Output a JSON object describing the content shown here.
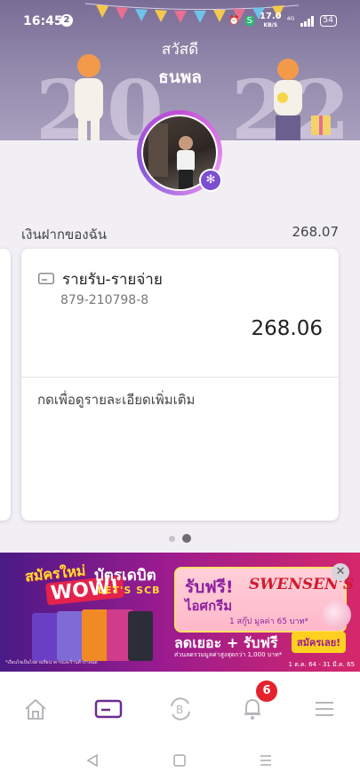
{
  "status_bar": {
    "time": "16:45",
    "notification_count": "2",
    "net_speed": "17.0",
    "net_unit": "KB/S",
    "battery": "54"
  },
  "header": {
    "greeting": "สวัสดี",
    "user_name": "ธนพล"
  },
  "deposits": {
    "label": "เงินฝากของฉัน",
    "total": "268.07"
  },
  "account_card": {
    "name": "รายรับ-รายจ่าย",
    "number": "879-210798-8",
    "balance": "268.06",
    "details_link": "กดเพื่อดูรายละเอียดเพิ่มเติม"
  },
  "pager": {
    "total": 2,
    "active": 2
  },
  "promo": {
    "tagline": "สมัครใหม่",
    "wow": "WOW!",
    "title": "บัตรเดบิต",
    "brand": "LET'S SCB",
    "offer_line1": "รับฟรี!",
    "offer_line2": "ไอศกรีม",
    "offer_brand": "SWENSEN'S",
    "offer_detail": "1 สกู๊ป มูลค่า 65 บาท*",
    "deal": "ลดเยอะ + รับฟรี",
    "deal_sub": "ส่วนลดรวมมูลค่าสูงสุดกว่า 1,000 บาท*",
    "apply_button": "สมัครเลย!",
    "period": "1 ต.ค. 64 - 31 มี.ค. 65",
    "fine_print": "*เงื่อนไขเป็นไปตามที่ธนาคารและร้านค้ากำหนด",
    "close_icon": "close-icon"
  },
  "tab_bar": {
    "items": [
      {
        "icon": "home-icon"
      },
      {
        "icon": "card-icon",
        "active": true
      },
      {
        "icon": "transfer-icon"
      },
      {
        "icon": "bell-icon",
        "badge": "6"
      },
      {
        "icon": "menu-icon"
      }
    ],
    "active_color": "#6a2c91",
    "inactive_color": "#b8b6bc"
  },
  "colors": {
    "brand_purple": "#6a2c91",
    "badge_red": "#e5212b"
  }
}
